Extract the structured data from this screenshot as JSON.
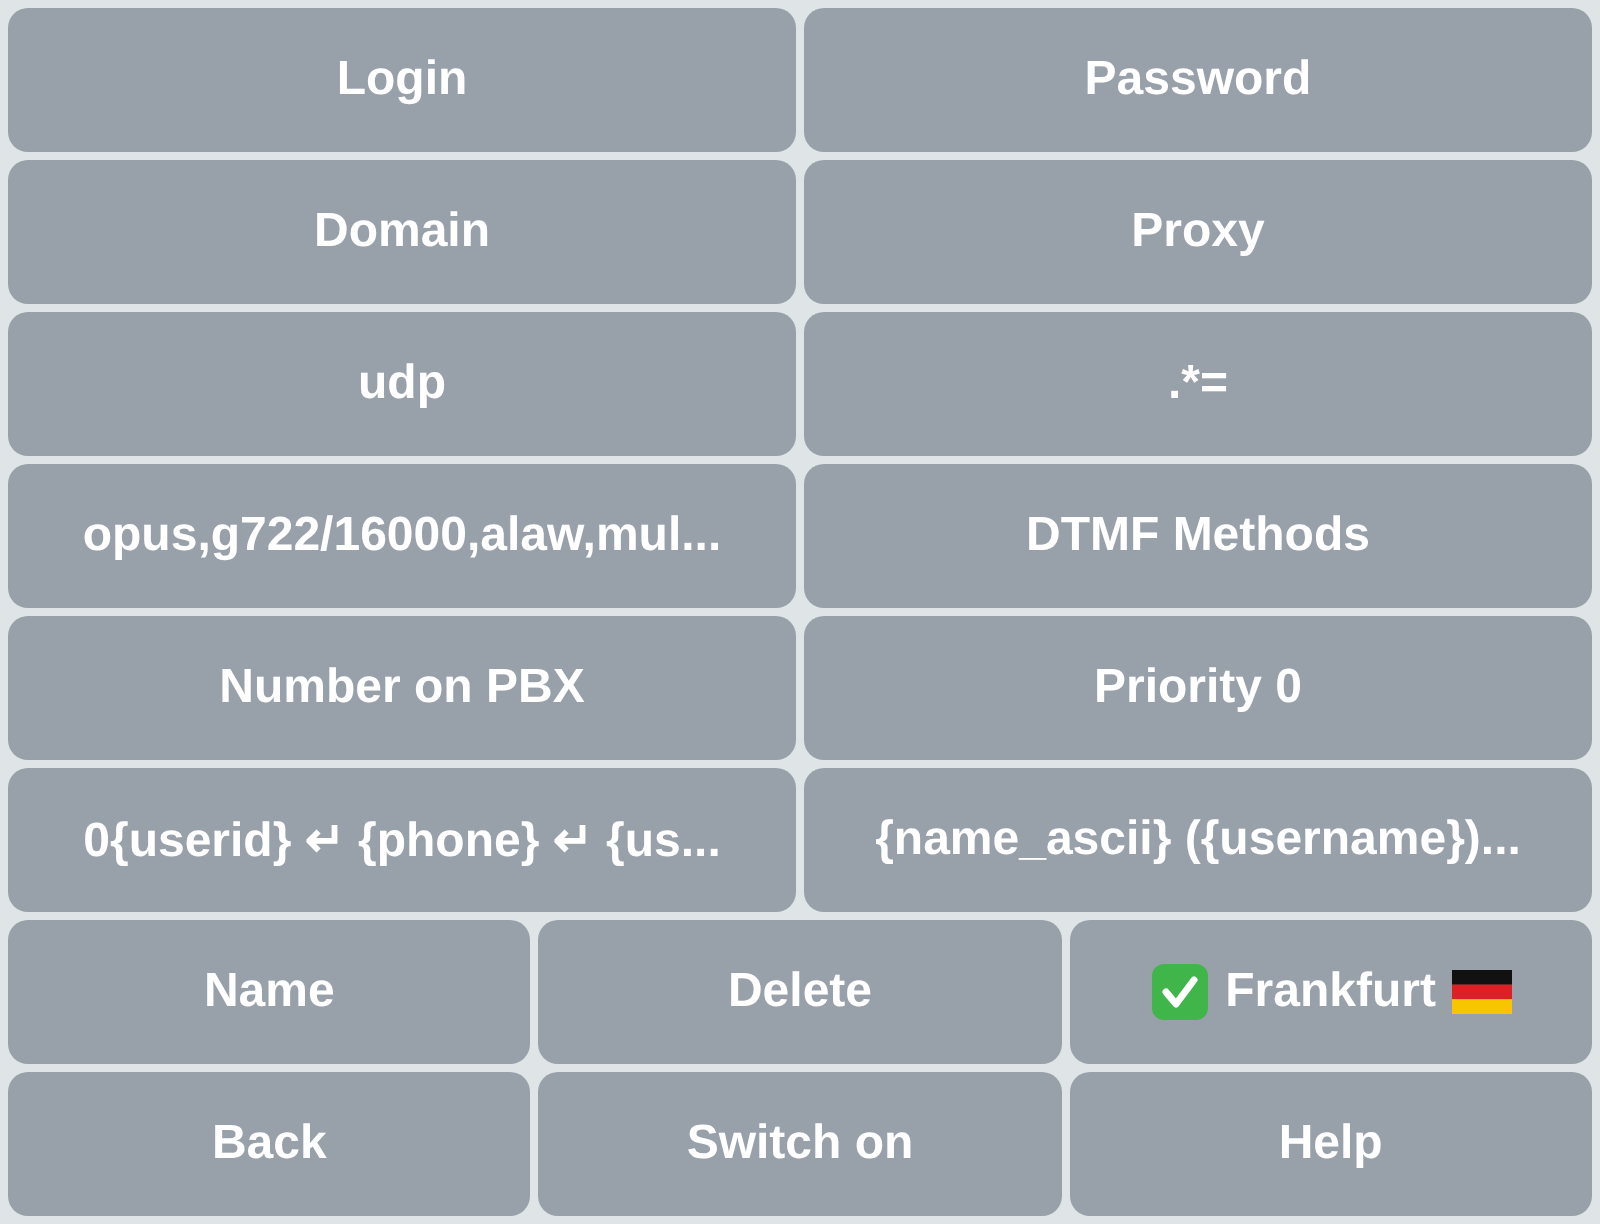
{
  "keyboard": {
    "rows": [
      [
        {
          "label": "Login"
        },
        {
          "label": "Password"
        }
      ],
      [
        {
          "label": "Domain"
        },
        {
          "label": "Proxy"
        }
      ],
      [
        {
          "label": "udp"
        },
        {
          "label": ".*="
        }
      ],
      [
        {
          "label": "opus,g722/16000,alaw,mul..."
        },
        {
          "label": "DTMF Methods"
        }
      ],
      [
        {
          "label": "Number on PBX"
        },
        {
          "label": "Priority 0"
        }
      ],
      [
        {
          "label": "0{userid} ↵ {phone} ↵ {us..."
        },
        {
          "label": "{name_ascii} ({username})..."
        }
      ],
      [
        {
          "label": "Name"
        },
        {
          "label": "Delete"
        },
        {
          "label": "Frankfurt",
          "kind": "location",
          "checked": true
        }
      ],
      [
        {
          "label": "Back"
        },
        {
          "label": "Switch on"
        },
        {
          "label": "Help"
        }
      ]
    ]
  }
}
